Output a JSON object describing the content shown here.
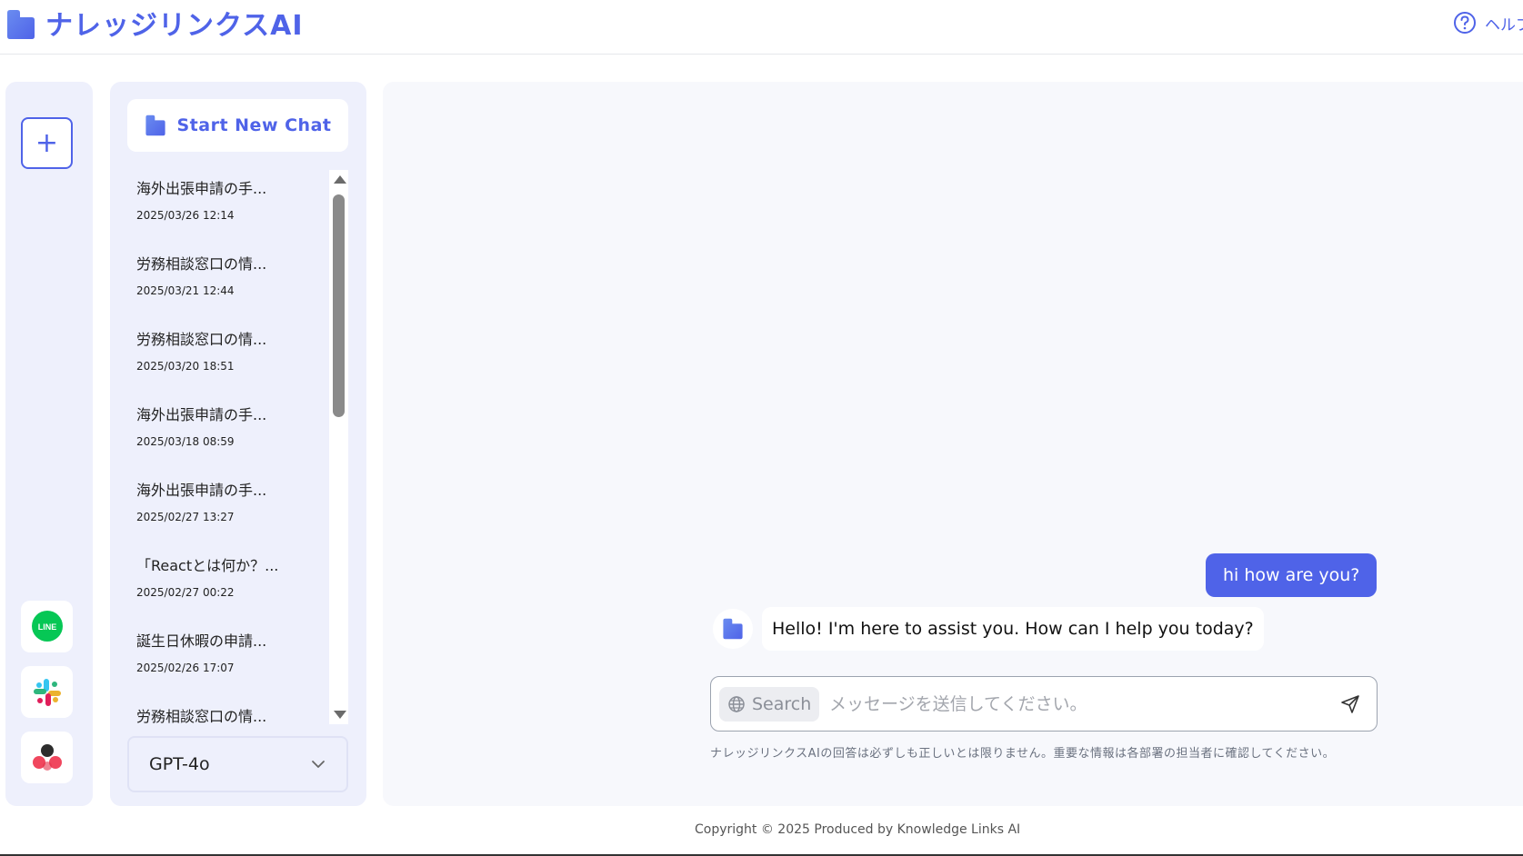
{
  "header": {
    "brand": "ナレッジリンクスAI",
    "help_label": "ヘルプ",
    "logo_icon": "folder-logo-icon",
    "help_icon": "question-circle-icon"
  },
  "rail": {
    "new_icon": "plus-icon",
    "apps": [
      {
        "name": "line-app",
        "icon": "line-logo-icon"
      },
      {
        "name": "slack-app",
        "icon": "slack-logo-icon"
      },
      {
        "name": "asana-app",
        "icon": "asana-logo-icon"
      }
    ]
  },
  "history": {
    "start_label": "Start New Chat",
    "items": [
      {
        "title": "海外出張申請の手...",
        "date": "2025/03/26 12:14"
      },
      {
        "title": "労務相談窓口の情...",
        "date": "2025/03/21 12:44"
      },
      {
        "title": "労務相談窓口の情...",
        "date": "2025/03/20 18:51"
      },
      {
        "title": "海外出張申請の手...",
        "date": "2025/03/18 08:59"
      },
      {
        "title": "海外出張申請の手...",
        "date": "2025/02/27 13:27"
      },
      {
        "title": "「Reactとは何か？...",
        "date": "2025/02/27 00:22"
      },
      {
        "title": "誕生日休暇の申請...",
        "date": "2025/02/26 17:07"
      },
      {
        "title": "労務相談窓口の情...",
        "date": ""
      }
    ],
    "model": "GPT-4o"
  },
  "conversation": {
    "user_message": "hi how are you?",
    "bot_message": "Hello! I'm here to assist you. How can I help you today?"
  },
  "composer": {
    "search_label": "Search",
    "placeholder": "メッセージを送信してください。",
    "disclaimer": "ナレッジリンクスAIの回答は必ずしも正しいとは限りません。重要な情報は各部署の担当者に確認してください。"
  },
  "footer": {
    "copyright": "Copyright © 2025 Produced by Knowledge Links AI"
  },
  "colors": {
    "accent": "#4f63e8",
    "panel_bg": "#eef0fc",
    "main_bg": "#f7f8fc"
  }
}
